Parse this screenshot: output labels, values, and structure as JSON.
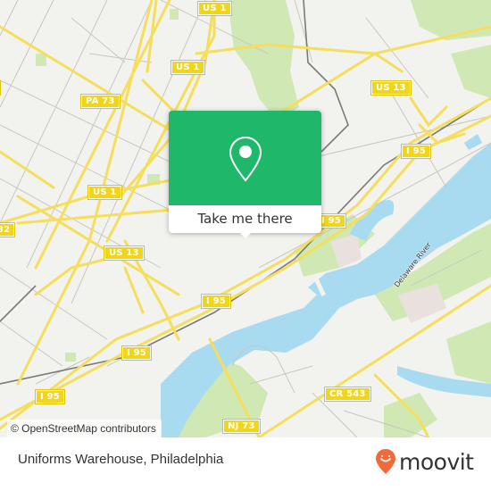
{
  "map": {
    "colors": {
      "land": "#f2f2ef",
      "water": "#a8daf0",
      "park": "#cfe8b4",
      "highway": "#f5de5c",
      "road_minor": "#c9c7c2",
      "rail": "#7a7a7a",
      "shield": "#f0d51a",
      "industrial": "#e8e1dd"
    },
    "shields": [
      {
        "label": "US 1"
      },
      {
        "label": "US 1"
      },
      {
        "label": "PA 73"
      },
      {
        "label": "US 1"
      },
      {
        "label": "US 13"
      },
      {
        "label": "US 13"
      },
      {
        "label": "I 95"
      },
      {
        "label": "I 95"
      },
      {
        "label": "I 95"
      },
      {
        "label": "I 95"
      },
      {
        "label": "I 95"
      },
      {
        "label": "I 95"
      },
      {
        "label": "CR 543"
      },
      {
        "label": "NJ 73"
      },
      {
        "label": "32"
      },
      {
        "label": ""
      }
    ],
    "water_label": "Delaware River",
    "attribution": "© OpenStreetMap contributors"
  },
  "popup": {
    "icon": "map-pin-icon",
    "action_label": "Take me there",
    "accent": "#1fb86a"
  },
  "footer": {
    "place_title": "Uniforms Warehouse, Philadelphia",
    "brand": "moovit",
    "brand_color": "#f26a3b"
  }
}
